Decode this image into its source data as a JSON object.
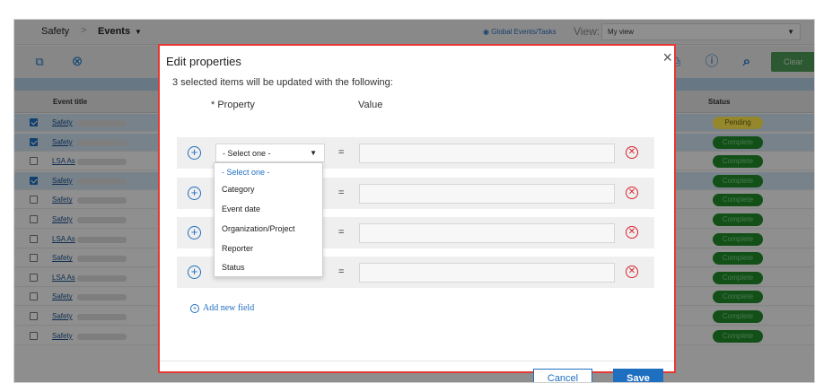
{
  "breadcrumb": {
    "module": "Safety",
    "current": "Events"
  },
  "header": {
    "global_link": "Global Events/Tasks",
    "view_label": "View:",
    "view_value": "My view"
  },
  "toolbar": {
    "clear_label": "Clear"
  },
  "grid": {
    "col_event_title": "Event title",
    "col_status": "Status",
    "rows": [
      {
        "title": "Safety",
        "selected": true,
        "status": "Pending"
      },
      {
        "title": "Safety",
        "selected": true,
        "status": "Complete"
      },
      {
        "title": "LSA As",
        "selected": false,
        "status": "Complete"
      },
      {
        "title": "Safety",
        "selected": true,
        "status": "Complete"
      },
      {
        "title": "Safety",
        "selected": false,
        "status": "Complete"
      },
      {
        "title": "Safety",
        "selected": false,
        "status": "Complete"
      },
      {
        "title": "LSA As",
        "selected": false,
        "status": "Complete"
      },
      {
        "title": "Safety",
        "selected": false,
        "status": "Complete"
      },
      {
        "title": "LSA As",
        "selected": false,
        "status": "Complete"
      },
      {
        "title": "Safety",
        "selected": false,
        "status": "Complete"
      },
      {
        "title": "Safety",
        "selected": false,
        "status": "Complete"
      },
      {
        "title": "Safety",
        "selected": false,
        "status": "Complete"
      }
    ]
  },
  "modal": {
    "title": "Edit properties",
    "close_glyph": "×",
    "subtitle": "3 selected items will be updated with the following:",
    "col_property": "* Property",
    "col_value": "Value",
    "select_placeholder": "- Select one -",
    "equals": "=",
    "dropdown_options": [
      "- Select one -",
      "Category",
      "Event date",
      "Organization/Project",
      "Reporter",
      "Status"
    ],
    "add_field_label": "Add new field",
    "cancel_label": "Cancel",
    "save_label": "Save"
  },
  "colors": {
    "accent": "#1f6fc0",
    "danger": "#d9232f",
    "modal_border": "#e53935",
    "complete": "#1f8a2a",
    "pending": "#ffe94d"
  },
  "icons": [
    "plus-circle-icon",
    "remove-circle-icon",
    "close-icon",
    "globe-icon",
    "info-icon",
    "search-icon",
    "export-icon",
    "cancel-circle-icon",
    "chevron-down-icon"
  ]
}
